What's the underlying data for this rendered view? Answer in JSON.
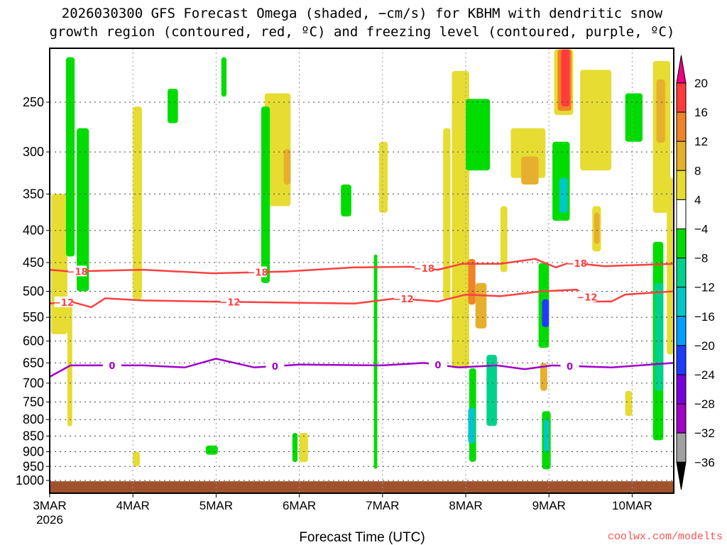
{
  "chart_data": {
    "type": "heatmap",
    "title_lines": [
      "2026030300 GFS Forecast Omega (shaded, −cm/s) for KBHM with dendritic snow",
      "growth region (contoured, red, ºC) and freezing level (contoured, purple, ºC)"
    ],
    "xlabel": "Forecast Time (UTC)",
    "ylabel": "",
    "credit": "coolwx.com/modelts",
    "x_unit": "hours from 2026-03-03 00Z",
    "xlim": [
      0,
      180
    ],
    "ylim_hpa": [
      1047,
      205
    ],
    "y_scale": "log",
    "x_ticks": [
      {
        "hour": 0,
        "label": "3MAR",
        "sublabel": "2026"
      },
      {
        "hour": 24,
        "label": "4MAR"
      },
      {
        "hour": 48,
        "label": "5MAR"
      },
      {
        "hour": 72,
        "label": "6MAR"
      },
      {
        "hour": 96,
        "label": "7MAR"
      },
      {
        "hour": 120,
        "label": "8MAR"
      },
      {
        "hour": 144,
        "label": "9MAR"
      },
      {
        "hour": 168,
        "label": "10MAR"
      }
    ],
    "y_ticks": [
      250,
      300,
      350,
      400,
      450,
      500,
      550,
      600,
      650,
      700,
      750,
      800,
      850,
      900,
      950,
      1000
    ],
    "grid": true,
    "surface_pressure_hpa": 1003,
    "colorbar": {
      "labels": [
        "20",
        "16",
        "12",
        "8",
        "4",
        "−4",
        "−8",
        "−12",
        "−16",
        "−20",
        "−24",
        "−28",
        "−32",
        "−36"
      ],
      "bins": [
        {
          "min": 16,
          "max": 20,
          "color": "#ff3c3c"
        },
        {
          "min": 12,
          "max": 16,
          "color": "#f08228"
        },
        {
          "min": 8,
          "max": 12,
          "color": "#e6af2d"
        },
        {
          "min": 4,
          "max": 8,
          "color": "#e6dc32"
        },
        {
          "min": -4,
          "max": 4,
          "color": "#ffffff"
        },
        {
          "min": -8,
          "max": -4,
          "color": "#00dc00"
        },
        {
          "min": -12,
          "max": -8,
          "color": "#00d28c"
        },
        {
          "min": -16,
          "max": -12,
          "color": "#00c8c8"
        },
        {
          "min": -20,
          "max": -16,
          "color": "#00a0ff"
        },
        {
          "min": -24,
          "max": -20,
          "color": "#1e3cff"
        },
        {
          "min": -28,
          "max": -24,
          "color": "#7800dc"
        },
        {
          "min": -32,
          "max": -28,
          "color": "#a000c8"
        },
        {
          "min": -36,
          "max": -32,
          "color": "#a0a0a0"
        }
      ],
      "above_color": "#f00082",
      "below_color": "#000000"
    },
    "shaded_regions": [
      {
        "hours": [
          0.4,
          5.1
        ],
        "hpa": [
          350,
          585
        ],
        "value": 6
      },
      {
        "hours": [
          4.7,
          7.2
        ],
        "hpa": [
          212,
          440
        ],
        "value": -6
      },
      {
        "hours": [
          7.8,
          11.3
        ],
        "hpa": [
          275,
          500
        ],
        "value": -6
      },
      {
        "hours": [
          5.1,
          6.5
        ],
        "hpa": [
          515,
          820
        ],
        "value": 6
      },
      {
        "hours": [
          24,
          26.6
        ],
        "hpa": [
          254,
          515
        ],
        "value": 6
      },
      {
        "hours": [
          24,
          26
        ],
        "hpa": [
          900,
          950
        ],
        "value": 6
      },
      {
        "hours": [
          34,
          37
        ],
        "hpa": [
          238,
          270
        ],
        "value": -6
      },
      {
        "hours": [
          49.5,
          51
        ],
        "hpa": [
          212,
          245
        ],
        "value": -6
      },
      {
        "hours": [
          45,
          48.5
        ],
        "hpa": [
          880,
          910
        ],
        "value": -6
      },
      {
        "hours": [
          62,
          69.5
        ],
        "hpa": [
          242,
          366
        ],
        "value": 6
      },
      {
        "hours": [
          67.5,
          69.5
        ],
        "hpa": [
          297,
          338
        ],
        "value": 10
      },
      {
        "hours": [
          61,
          63.5
        ],
        "hpa": [
          254,
          485
        ],
        "value": -6
      },
      {
        "hours": [
          70,
          71.5
        ],
        "hpa": [
          840,
          935
        ],
        "value": -6
      },
      {
        "hours": [
          72,
          74.5
        ],
        "hpa": [
          840,
          935
        ],
        "value": 6
      },
      {
        "hours": [
          84,
          87
        ],
        "hpa": [
          338,
          380
        ],
        "value": -6
      },
      {
        "hours": [
          95,
          97.5
        ],
        "hpa": [
          289,
          375
        ],
        "value": 6
      },
      {
        "hours": [
          93.5,
          94.5
        ],
        "hpa": [
          437,
          958
        ],
        "value": -6
      },
      {
        "hours": [
          113.5,
          115.6
        ],
        "hpa": [
          275,
          515
        ],
        "value": 6
      },
      {
        "hours": [
          116,
          121
        ],
        "hpa": [
          223,
          663
        ],
        "value": 6
      },
      {
        "hours": [
          120,
          127
        ],
        "hpa": [
          247,
          321
        ],
        "value": -6
      },
      {
        "hours": [
          120.7,
          122.8
        ],
        "hpa": [
          444,
          525
        ],
        "value": 12
      },
      {
        "hours": [
          122.8,
          126
        ],
        "hpa": [
          485,
          573
        ],
        "value": 8
      },
      {
        "hours": [
          121,
          123
        ],
        "hpa": [
          663,
          934
        ],
        "value": -6
      },
      {
        "hours": [
          120.7,
          122.8
        ],
        "hpa": [
          766,
          873
        ],
        "value": -14
      },
      {
        "hours": [
          126,
          129
        ],
        "hpa": [
          631,
          819
        ],
        "value": -10
      },
      {
        "hours": [
          130,
          132
        ],
        "hpa": [
          366,
          466
        ],
        "value": 6
      },
      {
        "hours": [
          133,
          143
        ],
        "hpa": [
          275,
          330
        ],
        "value": 6
      },
      {
        "hours": [
          136,
          141
        ],
        "hpa": [
          305,
          338
        ],
        "value": 10
      },
      {
        "hours": [
          145,
          150
        ],
        "hpa": [
          289,
          386
        ],
        "value": -6
      },
      {
        "hours": [
          147,
          149.4
        ],
        "hpa": [
          330,
          375
        ],
        "value": -14
      },
      {
        "hours": [
          145.5,
          151
        ],
        "hpa": [
          206,
          262
        ],
        "value": 6
      },
      {
        "hours": [
          146.5,
          150.5
        ],
        "hpa": [
          206,
          258
        ],
        "value": 14
      },
      {
        "hours": [
          147.5,
          150
        ],
        "hpa": [
          206,
          254
        ],
        "value": 18
      },
      {
        "hours": [
          153,
          162
        ],
        "hpa": [
          222,
          321
        ],
        "value": 6
      },
      {
        "hours": [
          166,
          171
        ],
        "hpa": [
          242,
          289
        ],
        "value": -6
      },
      {
        "hours": [
          174,
          179
        ],
        "hpa": [
          215,
          375
        ],
        "value": 6
      },
      {
        "hours": [
          175,
          177.5
        ],
        "hpa": [
          230,
          290
        ],
        "value": 10
      },
      {
        "hours": [
          141,
          144
        ],
        "hpa": [
          451,
          615
        ],
        "value": -6
      },
      {
        "hours": [
          142,
          144
        ],
        "hpa": [
          515,
          570
        ],
        "value": -22
      },
      {
        "hours": [
          141.5,
          143.5
        ],
        "hpa": [
          650,
          720
        ],
        "value": 10
      },
      {
        "hours": [
          142,
          144.5
        ],
        "hpa": [
          776,
          960
        ],
        "value": -6
      },
      {
        "hours": [
          142.5,
          144
        ],
        "hpa": [
          800,
          900
        ],
        "value": -14
      },
      {
        "hours": [
          174,
          177
        ],
        "hpa": [
          417,
          863
        ],
        "value": -6
      },
      {
        "hours": [
          174.5,
          177
        ],
        "hpa": [
          485,
          720
        ],
        "value": -10
      },
      {
        "hours": [
          178,
          180
        ],
        "hpa": [
          330,
          630
        ],
        "value": 6
      },
      {
        "hours": [
          156.5,
          159
        ],
        "hpa": [
          366,
          432
        ],
        "value": 6
      },
      {
        "hours": [
          157,
          158.6
        ],
        "hpa": [
          375,
          420
        ],
        "value": 10
      },
      {
        "hours": [
          166,
          168
        ],
        "hpa": [
          720,
          790
        ],
        "value": 6
      }
    ],
    "contours": [
      {
        "name": "dgz -18C",
        "value": "−18",
        "color": "#ff4040",
        "points": [
          [
            0,
            462
          ],
          [
            6,
            465
          ],
          [
            27,
            462
          ],
          [
            47,
            468
          ],
          [
            68,
            465
          ],
          [
            88,
            458
          ],
          [
            104,
            457
          ],
          [
            112,
            462
          ],
          [
            119,
            452
          ],
          [
            130,
            452
          ],
          [
            140,
            444
          ],
          [
            146,
            458
          ],
          [
            150,
            450
          ],
          [
            160,
            456
          ],
          [
            180,
            452
          ]
        ],
        "label_hours": [
          8,
          60,
          108,
          152
        ]
      },
      {
        "name": "dgz -12C",
        "value": "−12",
        "color": "#ff4040",
        "points": [
          [
            0,
            523
          ],
          [
            6,
            519
          ],
          [
            12,
            530
          ],
          [
            16,
            513
          ],
          [
            27,
            517
          ],
          [
            45,
            519
          ],
          [
            66,
            521
          ],
          [
            88,
            523
          ],
          [
            100,
            513
          ],
          [
            112,
            519
          ],
          [
            120,
            506
          ],
          [
            130,
            509
          ],
          [
            142,
            500
          ],
          [
            152,
            497
          ],
          [
            157,
            519
          ],
          [
            162,
            519
          ],
          [
            166,
            506
          ],
          [
            180,
            500
          ]
        ],
        "label_hours": [
          4,
          52,
          102,
          155
        ]
      },
      {
        "name": "freezing level 0C",
        "value": "0",
        "color": "#a000c8",
        "points": [
          [
            0,
            684
          ],
          [
            6,
            656
          ],
          [
            27,
            656
          ],
          [
            39,
            661
          ],
          [
            48,
            640
          ],
          [
            59,
            661
          ],
          [
            72,
            654
          ],
          [
            96,
            656
          ],
          [
            108,
            650
          ],
          [
            118,
            661
          ],
          [
            129,
            656
          ],
          [
            137,
            665
          ],
          [
            145,
            656
          ],
          [
            162,
            661
          ],
          [
            180,
            650
          ]
        ],
        "label_hours": [
          18,
          65,
          112,
          150
        ]
      }
    ]
  }
}
